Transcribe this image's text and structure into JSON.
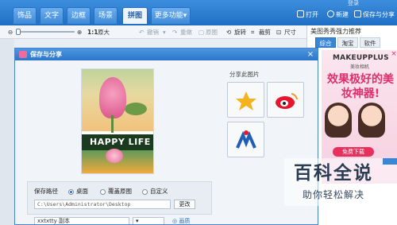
{
  "app": {
    "tabs": [
      "饰品",
      "文字",
      "边框",
      "场景",
      "拼图",
      "更多功能"
    ],
    "active_tab": "拼图",
    "login": "登录",
    "actions": {
      "open": "打开",
      "new": "新建",
      "save_share": "保存与分享"
    }
  },
  "toolbar": {
    "zoom_level": "1:1",
    "original_size": "原大",
    "undo": "撤销",
    "redo": "重做",
    "original_image": "原图",
    "rotate": "旋转",
    "crop": "裁剪",
    "resize": "尺寸"
  },
  "ad": {
    "title": "美图秀秀强力推荐",
    "tabs": [
      "综合",
      "淘宝",
      "软件"
    ],
    "active_tab": "综合",
    "brand": "MAKEUPPLUS",
    "brand_sub": "美妆相机",
    "headline": "效果极好的美妆神器!",
    "button": "免费下载"
  },
  "dialog": {
    "title": "保存与分享",
    "share_label": "分享此图片",
    "photo_text": "HAPPY LIFE",
    "save_path_label": "保存路径",
    "radio_desktop": "桌面",
    "radio_overwrite": "覆盖原图",
    "radio_custom": "自定义",
    "selected_radio": "桌面",
    "path_value": "C:\\Users\\Administrator\\Desktop",
    "change_button": "更改",
    "filename_value": "xxtxtty 副本",
    "quality_link": "画质"
  },
  "watermark": {
    "main": "百科全说",
    "sub": "助你轻松解决"
  },
  "colors": {
    "titlebar": "#2b76cb",
    "accent": "#e8305f",
    "tab_active_bg": "#eef4fb"
  }
}
